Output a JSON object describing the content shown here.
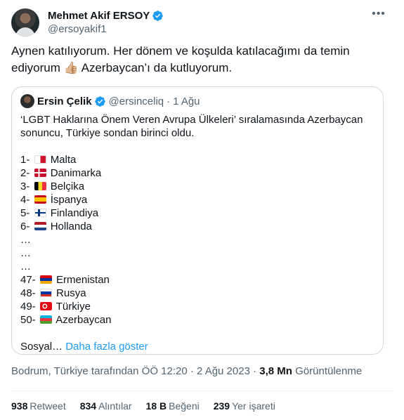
{
  "author": {
    "display_name": "Mehmet Akif ERSOY",
    "handle": "@ersoyakif1"
  },
  "tweet": {
    "text_line1": "Aynen katılıyorum. Her dönem ve koşulda katılacağımı da temin",
    "text_line2_before": "ediyorum",
    "text_line2_emoji": "👍🏼",
    "text_line2_after": "Azerbaycan’ı da kutluyorum."
  },
  "quoted": {
    "display_name": "Ersin Çelik",
    "handle": "@ersinceliq",
    "separator": "·",
    "date": "1 Ağu",
    "intro_line1": "‘LGBT Haklarına Önem Veren Avrupa Ülkeleri’ sıralamasında Azerbaycan",
    "intro_line2": "sonuncu, Türkiye sondan birinci oldu.",
    "rankings": [
      {
        "rank": "1-",
        "flag": "malta",
        "country": "Malta"
      },
      {
        "rank": "2-",
        "flag": "denmark",
        "country": "Danimarka"
      },
      {
        "rank": "3-",
        "flag": "belgium",
        "country": "Belçika"
      },
      {
        "rank": "4-",
        "flag": "spain",
        "country": "İspanya"
      },
      {
        "rank": "5-",
        "flag": "finland",
        "country": "Finlandiya"
      },
      {
        "rank": "6-",
        "flag": "netherlands",
        "country": "Hollanda"
      },
      {
        "rank": "47-",
        "flag": "armenia",
        "country": "Ermenistan"
      },
      {
        "rank": "48-",
        "flag": "russia",
        "country": "Rusya"
      },
      {
        "rank": "49-",
        "flag": "turkey",
        "country": "Türkiye"
      },
      {
        "rank": "50-",
        "flag": "azerbaijan",
        "country": "Azerbaycan"
      }
    ],
    "ellipsis": "…",
    "truncated_text": "Sosyal…",
    "show_more": "Daha fazla göster"
  },
  "meta": {
    "location_time": "Bodrum, Türkiye tarafından ÖÖ 12:20 · 2 Ağu 2023 ·",
    "views_count": "3,8 Mn",
    "views_label": "Görüntülenme"
  },
  "stats": {
    "retweets_count": "938",
    "retweets_label": "Retweet",
    "quotes_count": "834",
    "quotes_label": "Alıntılar",
    "likes_count": "18 B",
    "likes_label": "Beğeni",
    "bookmarks_count": "239",
    "bookmarks_label": "Yer işareti"
  },
  "colors": {
    "accent": "#1d9bf0",
    "secondary_text": "#536471",
    "border": "#cfd9de"
  }
}
